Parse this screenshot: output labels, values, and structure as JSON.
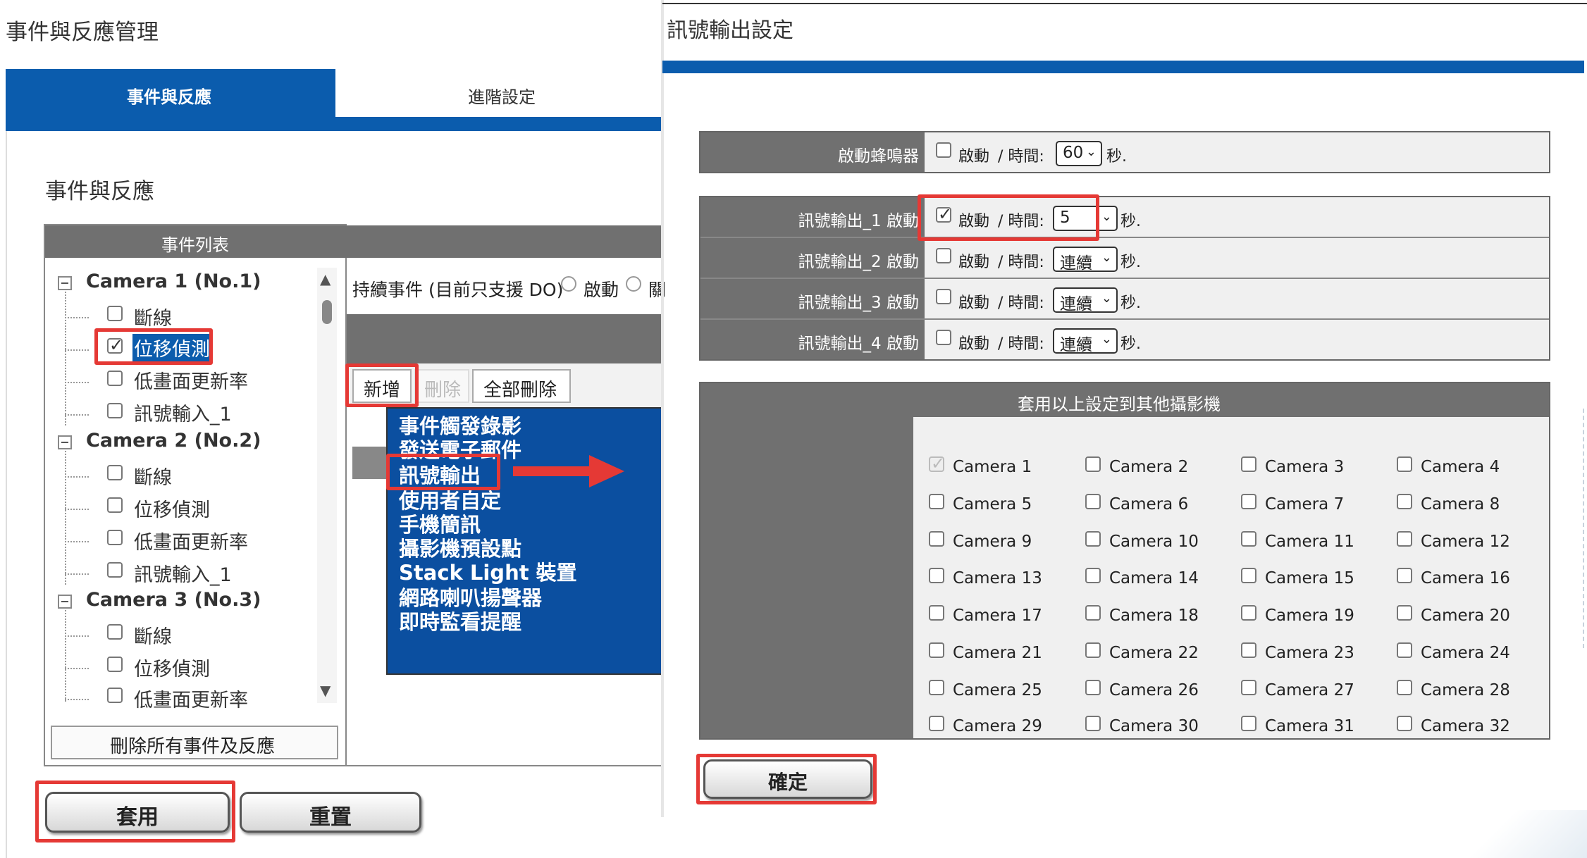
{
  "left_panel": {
    "page_title": "事件與反應管理",
    "tabs": [
      {
        "label": "事件與反應",
        "active": true
      },
      {
        "label": "進階設定",
        "active": false
      }
    ],
    "section_title": "事件與反應",
    "event_list_header": "事件列表",
    "tree": [
      {
        "camera": "Camera 1 (No.1)",
        "items": [
          {
            "label": "斷線",
            "checked": false
          },
          {
            "label": "位移偵測",
            "checked": true,
            "selected": true
          },
          {
            "label": "低畫面更新率",
            "checked": false
          },
          {
            "label": "訊號輸入_1",
            "checked": false
          }
        ]
      },
      {
        "camera": "Camera 2 (No.2)",
        "items": [
          {
            "label": "斷線",
            "checked": false
          },
          {
            "label": "位移偵測",
            "checked": false
          },
          {
            "label": "低畫面更新率",
            "checked": false
          },
          {
            "label": "訊號輸入_1",
            "checked": false
          }
        ]
      },
      {
        "camera": "Camera 3 (No.3)",
        "items": [
          {
            "label": "斷線",
            "checked": false
          },
          {
            "label": "位移偵測",
            "checked": false
          },
          {
            "label": "低畫面更新率",
            "checked": false
          }
        ]
      }
    ],
    "delete_all_label": "刪除所有事件及反應",
    "continuous_label": "持續事件 (目前只支援 DO)",
    "radio_enable": "啟動",
    "radio_disable": "關",
    "btn_add": "新增",
    "btn_delete": "刪除",
    "btn_delete_all": "全部刪除",
    "actions": [
      "事件觸發錄影",
      "發送電子郵件",
      "訊號輸出",
      "使用者自定",
      "手機簡訊",
      "攝影機預設點",
      "Stack Light 裝置",
      "網路喇叭揚聲器",
      "即時監看提醒"
    ],
    "btn_apply": "套用",
    "btn_reset": "重置"
  },
  "right_panel": {
    "page_title": "訊號輸出設定",
    "buzzer_label": "啟動蜂鳴器",
    "rows": [
      {
        "label": "訊號輸出_1 啟動",
        "checked": true,
        "value": "5"
      },
      {
        "label": "訊號輸出_2 啟動",
        "checked": false,
        "value": "連續"
      },
      {
        "label": "訊號輸出_3 啟動",
        "checked": false,
        "value": "連續"
      },
      {
        "label": "訊號輸出_4 啟動",
        "checked": false,
        "value": "連續"
      }
    ],
    "buzzer_value": "60",
    "enable_text": "啟動",
    "time_text": "/ 時間:",
    "sec_text": "秒.",
    "apply_header": "套用以上設定到其他攝影機",
    "cameras": [
      "Camera 1",
      "Camera 2",
      "Camera 3",
      "Camera 4",
      "Camera 5",
      "Camera 6",
      "Camera 7",
      "Camera 8",
      "Camera 9",
      "Camera 10",
      "Camera 11",
      "Camera 12",
      "Camera 13",
      "Camera 14",
      "Camera 15",
      "Camera 16",
      "Camera 17",
      "Camera 18",
      "Camera 19",
      "Camera 20",
      "Camera 21",
      "Camera 22",
      "Camera 23",
      "Camera 24",
      "Camera 25",
      "Camera 26",
      "Camera 27",
      "Camera 28",
      "Camera 29",
      "Camera 30",
      "Camera 31",
      "Camera 32"
    ],
    "btn_confirm": "確定"
  },
  "colors": {
    "accent_blue": "#0b5cad",
    "highlight_red": "#e53935",
    "header_gray": "#707070"
  }
}
